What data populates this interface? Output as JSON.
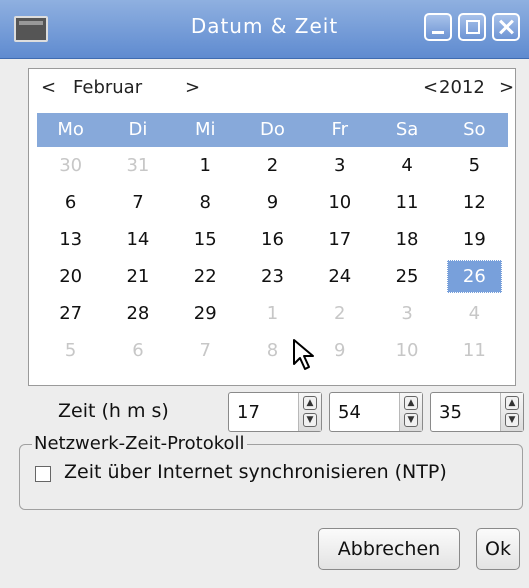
{
  "window": {
    "title": "Datum & Zeit"
  },
  "calendar": {
    "prev_month": "<",
    "month": "Februar",
    "next_month": ">",
    "prev_year": "<",
    "year": "2012",
    "next_year": ">",
    "weekdays": [
      "Mo",
      "Di",
      "Mi",
      "Do",
      "Fr",
      "Sa",
      "So"
    ],
    "days": [
      {
        "label": "30",
        "other": true
      },
      {
        "label": "31",
        "other": true
      },
      {
        "label": "1",
        "other": false
      },
      {
        "label": "2",
        "other": false
      },
      {
        "label": "3",
        "other": false
      },
      {
        "label": "4",
        "other": false
      },
      {
        "label": "5",
        "other": false
      },
      {
        "label": "6",
        "other": false
      },
      {
        "label": "7",
        "other": false
      },
      {
        "label": "8",
        "other": false
      },
      {
        "label": "9",
        "other": false
      },
      {
        "label": "10",
        "other": false
      },
      {
        "label": "11",
        "other": false
      },
      {
        "label": "12",
        "other": false
      },
      {
        "label": "13",
        "other": false
      },
      {
        "label": "14",
        "other": false
      },
      {
        "label": "15",
        "other": false
      },
      {
        "label": "16",
        "other": false
      },
      {
        "label": "17",
        "other": false
      },
      {
        "label": "18",
        "other": false
      },
      {
        "label": "19",
        "other": false
      },
      {
        "label": "20",
        "other": false
      },
      {
        "label": "21",
        "other": false
      },
      {
        "label": "22",
        "other": false
      },
      {
        "label": "23",
        "other": false
      },
      {
        "label": "24",
        "other": false
      },
      {
        "label": "25",
        "other": false
      },
      {
        "label": "26",
        "other": false,
        "selected": true
      },
      {
        "label": "27",
        "other": false
      },
      {
        "label": "28",
        "other": false
      },
      {
        "label": "29",
        "other": false
      },
      {
        "label": "1",
        "other": true
      },
      {
        "label": "2",
        "other": true
      },
      {
        "label": "3",
        "other": true
      },
      {
        "label": "4",
        "other": true
      },
      {
        "label": "5",
        "other": true
      },
      {
        "label": "6",
        "other": true
      },
      {
        "label": "7",
        "other": true
      },
      {
        "label": "8",
        "other": true
      },
      {
        "label": "9",
        "other": true
      },
      {
        "label": "10",
        "other": true
      },
      {
        "label": "11",
        "other": true
      }
    ]
  },
  "time": {
    "label": "Zeit (h m s)",
    "hours": "17",
    "minutes": "54",
    "seconds": "35"
  },
  "ntp": {
    "group_title": "Netzwerk-Zeit-Protokoll",
    "checkbox_label": "Zeit über Internet synchronisieren (NTP)",
    "checked": false
  },
  "buttons": {
    "cancel": "Abbrechen",
    "ok": "Ok"
  },
  "colors": {
    "titlebar": "#6f97d6",
    "header": "#87a9da",
    "selected": "#78a0db"
  }
}
